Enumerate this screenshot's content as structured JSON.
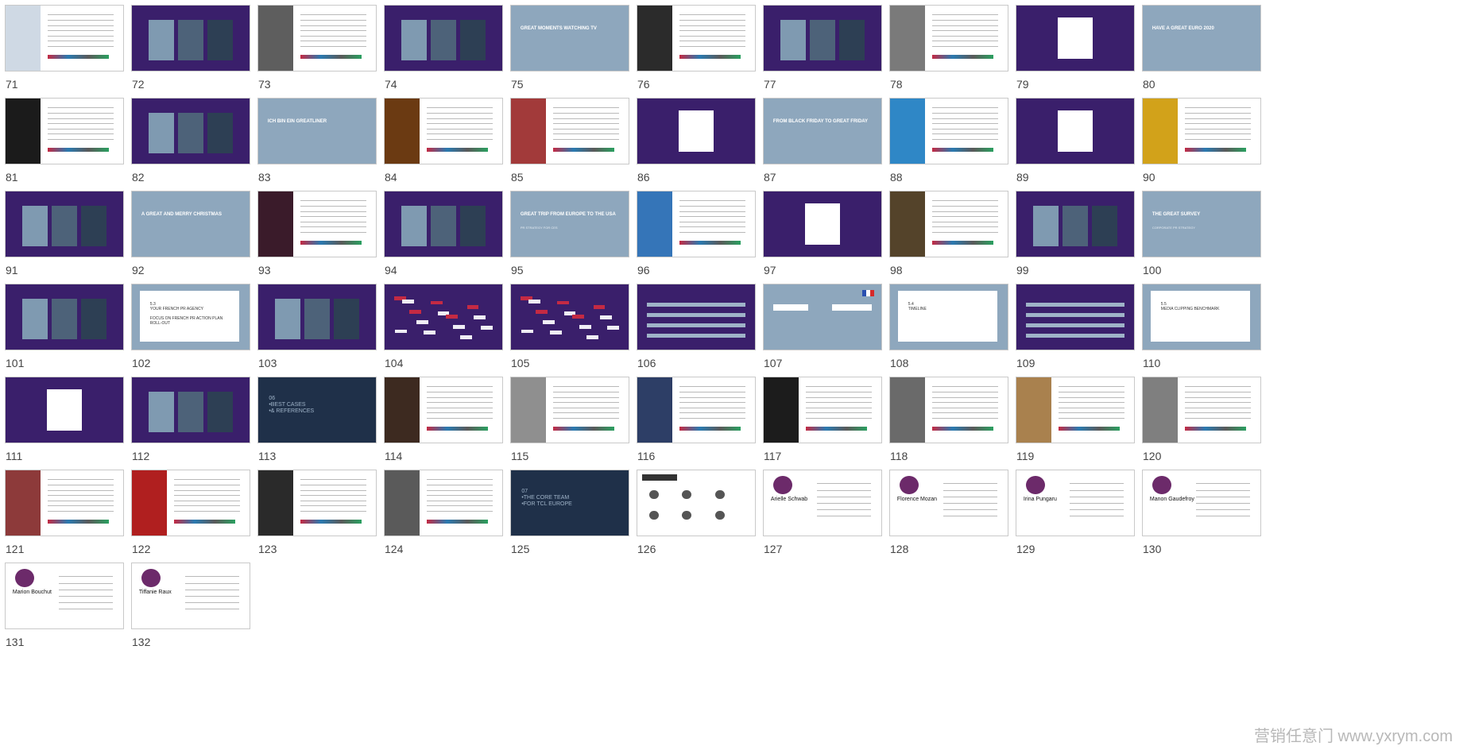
{
  "slides": [
    {
      "n": "71",
      "kind": "text-photo",
      "photo": "#cfd9e4"
    },
    {
      "n": "72",
      "kind": "purple-cols"
    },
    {
      "n": "73",
      "kind": "text-photo",
      "photo": "#5e5e5e"
    },
    {
      "n": "74",
      "kind": "purple-cols"
    },
    {
      "n": "75",
      "kind": "blue-title",
      "title": "GREAT MOMENTS WATCHING TV"
    },
    {
      "n": "76",
      "kind": "text-photo",
      "photo": "#2b2b2b"
    },
    {
      "n": "77",
      "kind": "purple-cols"
    },
    {
      "n": "78",
      "kind": "text-photo",
      "photo": "#7a7a7a"
    },
    {
      "n": "79",
      "kind": "purple-box"
    },
    {
      "n": "80",
      "kind": "blue-title",
      "title": "HAVE A GREAT EURO 2020"
    },
    {
      "n": "81",
      "kind": "text-photo",
      "photo": "#1b1b1b"
    },
    {
      "n": "82",
      "kind": "purple-cols"
    },
    {
      "n": "83",
      "kind": "blue-title",
      "title": "ICH BIN EIN GREATLINER"
    },
    {
      "n": "84",
      "kind": "text-photo",
      "photo": "#6b3a12"
    },
    {
      "n": "85",
      "kind": "text-photo",
      "photo": "#a23a3a"
    },
    {
      "n": "86",
      "kind": "purple-box"
    },
    {
      "n": "87",
      "kind": "blue-title",
      "title": "FROM BLACK FRIDAY TO GREAT FRIDAY"
    },
    {
      "n": "88",
      "kind": "text-photo",
      "photo": "#2f87c6"
    },
    {
      "n": "89",
      "kind": "purple-box"
    },
    {
      "n": "90",
      "kind": "text-photo",
      "photo": "#d2a21a"
    },
    {
      "n": "91",
      "kind": "purple-cols"
    },
    {
      "n": "92",
      "kind": "blue-title",
      "title": "A GREAT AND MERRY CHRISTMAS"
    },
    {
      "n": "93",
      "kind": "text-photo",
      "photo": "#3a1b2a"
    },
    {
      "n": "94",
      "kind": "purple-cols"
    },
    {
      "n": "95",
      "kind": "blue-title",
      "title": "GREAT TRIP FROM EUROPE TO THE USA",
      "sub": "PR STRATEGY FOR CES"
    },
    {
      "n": "96",
      "kind": "text-photo",
      "photo": "#3575b8"
    },
    {
      "n": "97",
      "kind": "purple-box"
    },
    {
      "n": "98",
      "kind": "text-photo",
      "photo": "#54432a"
    },
    {
      "n": "99",
      "kind": "purple-cols"
    },
    {
      "n": "100",
      "kind": "blue-title",
      "title": "THE GREAT SURVEY",
      "sub": "CORPORATE PR STRATEGY"
    },
    {
      "n": "101",
      "kind": "purple-cols"
    },
    {
      "n": "102",
      "kind": "blue-box",
      "text": "5.3\nYOUR FRENCH PR AGENCY\n\nFOCUS ON FRENCH PR ACTION PLAN ROLL-OUT"
    },
    {
      "n": "103",
      "kind": "purple-cols"
    },
    {
      "n": "104",
      "kind": "purple-map"
    },
    {
      "n": "105",
      "kind": "purple-map"
    },
    {
      "n": "106",
      "kind": "purple-bars"
    },
    {
      "n": "107",
      "kind": "blue-bars"
    },
    {
      "n": "108",
      "kind": "blue-box",
      "text": "5.4\nTIMELINE"
    },
    {
      "n": "109",
      "kind": "purple-bars"
    },
    {
      "n": "110",
      "kind": "blue-box",
      "text": "5.5\nMEDIA CLIPPING BENCHMARK"
    },
    {
      "n": "111",
      "kind": "purple-box"
    },
    {
      "n": "112",
      "kind": "purple-cols"
    },
    {
      "n": "113",
      "kind": "navy-title",
      "text": "06\n•BEST CASES\n•& REFERENCES"
    },
    {
      "n": "114",
      "kind": "text-photo",
      "photo": "#3d2a20"
    },
    {
      "n": "115",
      "kind": "text-photo",
      "photo": "#8f8f8f"
    },
    {
      "n": "116",
      "kind": "text-photo",
      "photo": "#2d3e66"
    },
    {
      "n": "117",
      "kind": "text-photo",
      "photo": "#1c1c1c"
    },
    {
      "n": "118",
      "kind": "text-photo",
      "photo": "#6a6a6a"
    },
    {
      "n": "119",
      "kind": "text-photo",
      "photo": "#a9814e"
    },
    {
      "n": "120",
      "kind": "text-photo",
      "photo": "#7f7f7f"
    },
    {
      "n": "121",
      "kind": "text-photo",
      "photo": "#8d3a3a"
    },
    {
      "n": "122",
      "kind": "text-photo",
      "photo": "#b01f1f"
    },
    {
      "n": "123",
      "kind": "text-photo",
      "photo": "#2a2a2a"
    },
    {
      "n": "124",
      "kind": "text-photo",
      "photo": "#5a5a5a"
    },
    {
      "n": "125",
      "kind": "navy-title",
      "text": "07\n•THE CORE TEAM\n•FOR TCL EUROPE"
    },
    {
      "n": "126",
      "kind": "org-chart"
    },
    {
      "n": "127",
      "kind": "profile",
      "name": "Arielle Schwab"
    },
    {
      "n": "128",
      "kind": "profile",
      "name": "Florence Mozan"
    },
    {
      "n": "129",
      "kind": "profile",
      "name": "Irina Pungaru"
    },
    {
      "n": "130",
      "kind": "profile",
      "name": "Manon Gaudefroy"
    },
    {
      "n": "131",
      "kind": "profile",
      "name": "Marion Bouchut"
    },
    {
      "n": "132",
      "kind": "profile",
      "name": "Tiffanie Raux"
    }
  ],
  "watermark": "营销任意门 www.yxrym.com"
}
